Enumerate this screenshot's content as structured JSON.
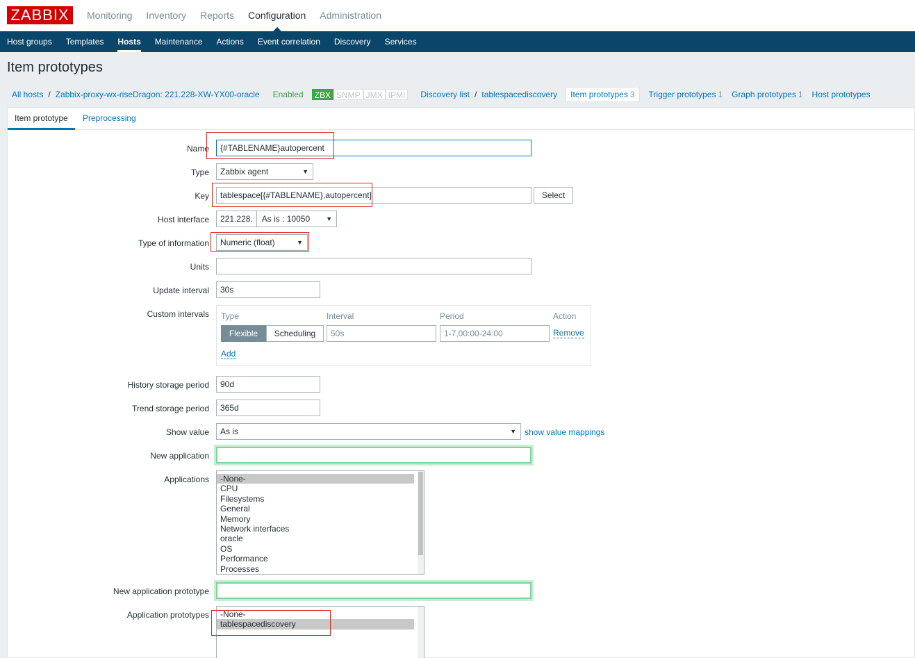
{
  "brand": {
    "logo_text": "ZABBIX",
    "accent": "#d40000",
    "nav_bg": "#0a466a"
  },
  "top_nav": [
    "Monitoring",
    "Inventory",
    "Reports",
    "Configuration",
    "Administration"
  ],
  "sub_nav": [
    "Host groups",
    "Templates",
    "Hosts",
    "Maintenance",
    "Actions",
    "Event correlation",
    "Discovery",
    "Services"
  ],
  "page_title": "Item prototypes",
  "breadcrumb": {
    "all_hosts": "All hosts",
    "host": "Zabbix-proxy-wx-riseDragon: 221.228-XW-YX00-oracle",
    "status": "Enabled",
    "availability": [
      "ZBX",
      "SNMP",
      "JMX",
      "IPMI"
    ],
    "discovery_list": "Discovery list",
    "discovery_rule": "tablespacediscovery",
    "item_prototypes": "Item prototypes",
    "item_prototypes_count": "3",
    "trigger_prototypes": "Trigger prototypes",
    "trigger_prototypes_count": "1",
    "graph_prototypes": "Graph prototypes",
    "graph_prototypes_count": "1",
    "host_prototypes": "Host prototypes"
  },
  "tabs": {
    "item_prototype": "Item prototype",
    "preprocessing": "Preprocessing"
  },
  "form": {
    "name_label": "Name",
    "name_value": "{#TABLENAME}autopercent",
    "type_label": "Type",
    "type_value": "Zabbix agent",
    "key_label": "Key",
    "key_value": "tablespace[{#TABLENAME},autopercent]",
    "select_button": "Select",
    "host_interface_label": "Host interface",
    "host_interface_ip": "221.228.",
    "host_interface_mode": "As is",
    "host_interface_port": ": 10050",
    "type_of_info_label": "Type of information",
    "type_of_info_value": "Numeric (float)",
    "units_label": "Units",
    "units_value": "",
    "update_interval_label": "Update interval",
    "update_interval_value": "30s",
    "custom_intervals_label": "Custom intervals",
    "ci_headers": {
      "type": "Type",
      "interval": "Interval",
      "period": "Period",
      "action": "Action"
    },
    "ci_flexible": "Flexible",
    "ci_scheduling": "Scheduling",
    "ci_interval_placeholder": "50s",
    "ci_period_placeholder": "1-7,00:00-24:00",
    "ci_remove": "Remove",
    "ci_add": "Add",
    "history_label": "History storage period",
    "history_value": "90d",
    "trend_label": "Trend storage period",
    "trend_value": "365d",
    "show_value_label": "Show value",
    "show_value_value": "As is",
    "show_value_mappings": "show value mappings",
    "new_application_label": "New application",
    "applications_label": "Applications",
    "applications": [
      "-None-",
      "CPU",
      "Filesystems",
      "General",
      "Memory",
      "Network interfaces",
      "oracle",
      "OS",
      "Performance",
      "Processes"
    ],
    "new_app_prototype_label": "New application prototype",
    "app_prototypes_label": "Application prototypes",
    "app_prototypes": [
      "-None-",
      "tablespacediscovery"
    ]
  }
}
